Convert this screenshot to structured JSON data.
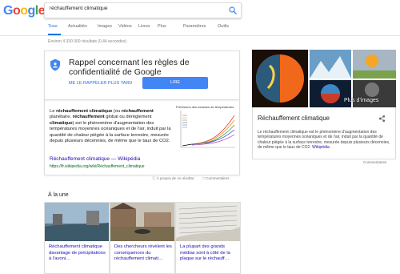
{
  "logo": {
    "letters": [
      "G",
      "o",
      "o",
      "g",
      "l",
      "e"
    ]
  },
  "search": {
    "value": "réchauffement climatique"
  },
  "tabs": [
    {
      "label": "Tous",
      "active": true
    },
    {
      "label": "Actualités"
    },
    {
      "label": "Images"
    },
    {
      "label": "Vidéos"
    },
    {
      "label": "Livres"
    },
    {
      "label": "Plus"
    },
    {
      "label": "Paramètres"
    },
    {
      "label": "Outils"
    }
  ],
  "stats": "Environ 4 330 000 résultats (0,44 secondes)",
  "privacy": {
    "title": "Rappel concernant les règles de confidentialité de Google",
    "later": "ME LE RAPPELER PLUS TARD",
    "read": "LIRE"
  },
  "snippet": {
    "text_parts": [
      {
        "t": "Le ",
        "b": false
      },
      {
        "t": "réchauffement climatique",
        "b": true
      },
      {
        "t": " (ou ",
        "b": false
      },
      {
        "t": "réchauffement",
        "b": true
      },
      {
        "t": " planétaire, ",
        "b": false
      },
      {
        "t": "réchauffement",
        "b": true
      },
      {
        "t": " global ou dérèglement ",
        "b": false
      },
      {
        "t": "climatique",
        "b": true
      },
      {
        "t": ") est le phénomène d'augmentation des températures moyennes océaniques et de l'air, induit par la quantité de chaleur piégée à la surface terrestre, mesurée depuis plusieurs décennies, de même que le taux de CO2.",
        "b": false
      }
    ],
    "link": "Réchauffement climatique — Wikipédia",
    "url": "https://fr.wikipedia.org/wiki/Réchauffement_climatique",
    "chart_title": "Prévisions des hausses de températures"
  },
  "below_snippet": {
    "about": "À propos de ce résultat",
    "comments": "Commentaires"
  },
  "a_la_une": "À la une",
  "news": [
    {
      "title": "Réchauffement climatique davantage de précipitations à l'avoni…"
    },
    {
      "title": "Des chercheurs révèlent les conséquences du réchauffement climati…"
    },
    {
      "title": "La plupart des grands médias sont à côté de la plaque sur le réchauff…"
    }
  ],
  "knowledge_panel": {
    "title": "Réchauffement climatique",
    "plus_images": "Plus d'images",
    "text": "Le réchauffement climatique est le phénomène d'augmentation des températures moyennes océaniques et de l'air, induit par la quantité de chaleur piégée à la surface terrestre, mesurée depuis plusieurs décennies, de même que le taux de CO2.",
    "wiki": "Wikipédia",
    "comments": "Commentaires"
  },
  "colors": {
    "accent": "#1a73e8",
    "link": "#1a0dab",
    "url": "#006621",
    "button": "#4285f4"
  }
}
